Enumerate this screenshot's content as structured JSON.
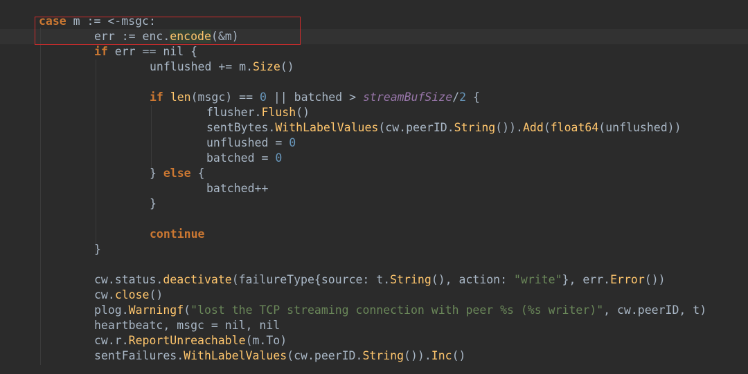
{
  "editor": {
    "theme_colors": {
      "background": "#2b2b2b",
      "caret_row": "#323232",
      "keyword": "#cc7832",
      "function": "#ffc66d",
      "string": "#6a8759",
      "number": "#6897bb",
      "constant": "#9876aa",
      "default": "#a9b7c6",
      "highlight_box": "#d22b2b"
    },
    "lines": [
      [
        {
          "t": "kw",
          "v": "case"
        },
        {
          "t": "",
          "v": " m := <-msgc:"
        }
      ],
      [
        {
          "t": "",
          "v": "err := enc."
        },
        {
          "t": "fn hl",
          "v": "encode"
        },
        {
          "t": "",
          "v": "(&m)"
        }
      ],
      [
        {
          "t": "kw",
          "v": "if"
        },
        {
          "t": "",
          "v": " err == nil {"
        }
      ],
      [
        {
          "t": "",
          "v": "unflushed += m."
        },
        {
          "t": "fn",
          "v": "Size"
        },
        {
          "t": "",
          "v": "()"
        }
      ],
      [],
      [
        {
          "t": "kw",
          "v": "if"
        },
        {
          "t": "",
          "v": " "
        },
        {
          "t": "fn",
          "v": "len"
        },
        {
          "t": "",
          "v": "(msgc) == "
        },
        {
          "t": "num",
          "v": "0"
        },
        {
          "t": "",
          "v": " || batched > "
        },
        {
          "t": "const",
          "v": "streamBufSize"
        },
        {
          "t": "",
          "v": "/"
        },
        {
          "t": "num",
          "v": "2"
        },
        {
          "t": "",
          "v": " {"
        }
      ],
      [
        {
          "t": "",
          "v": "flusher."
        },
        {
          "t": "fn",
          "v": "Flush"
        },
        {
          "t": "",
          "v": "()"
        }
      ],
      [
        {
          "t": "",
          "v": "sentBytes."
        },
        {
          "t": "fn",
          "v": "WithLabelValues"
        },
        {
          "t": "",
          "v": "(cw.peerID."
        },
        {
          "t": "fn",
          "v": "String"
        },
        {
          "t": "",
          "v": "())."
        },
        {
          "t": "fn",
          "v": "Add"
        },
        {
          "t": "",
          "v": "("
        },
        {
          "t": "fn",
          "v": "float64"
        },
        {
          "t": "",
          "v": "(unflushed))"
        }
      ],
      [
        {
          "t": "",
          "v": "unflushed = "
        },
        {
          "t": "num",
          "v": "0"
        }
      ],
      [
        {
          "t": "",
          "v": "batched = "
        },
        {
          "t": "num",
          "v": "0"
        }
      ],
      [
        {
          "t": "",
          "v": "} "
        },
        {
          "t": "kw",
          "v": "else"
        },
        {
          "t": "",
          "v": " {"
        }
      ],
      [
        {
          "t": "",
          "v": "batched++"
        }
      ],
      [
        {
          "t": "",
          "v": "}"
        }
      ],
      [],
      [
        {
          "t": "kw",
          "v": "continue"
        }
      ],
      [
        {
          "t": "",
          "v": "}"
        }
      ],
      [],
      [
        {
          "t": "",
          "v": "cw.status."
        },
        {
          "t": "fn",
          "v": "deactivate"
        },
        {
          "t": "",
          "v": "(failureType{source: t."
        },
        {
          "t": "fn",
          "v": "String"
        },
        {
          "t": "",
          "v": "(), action: "
        },
        {
          "t": "str",
          "v": "\"write\""
        },
        {
          "t": "",
          "v": "}, err."
        },
        {
          "t": "fn",
          "v": "Error"
        },
        {
          "t": "",
          "v": "())"
        }
      ],
      [
        {
          "t": "",
          "v": "cw."
        },
        {
          "t": "fn",
          "v": "close"
        },
        {
          "t": "",
          "v": "()"
        }
      ],
      [
        {
          "t": "",
          "v": "plog."
        },
        {
          "t": "fn",
          "v": "Warningf"
        },
        {
          "t": "",
          "v": "("
        },
        {
          "t": "str",
          "v": "\"lost the TCP streaming connection with peer %s (%s writer)\""
        },
        {
          "t": "",
          "v": ", cw.peerID, t)"
        }
      ],
      [
        {
          "t": "",
          "v": "heartbeatc, msgc = nil, nil"
        }
      ],
      [
        {
          "t": "",
          "v": "cw.r."
        },
        {
          "t": "fn",
          "v": "ReportUnreachable"
        },
        {
          "t": "",
          "v": "(m.To)"
        }
      ],
      [
        {
          "t": "",
          "v": "sentFailures."
        },
        {
          "t": "fn",
          "v": "WithLabelValues"
        },
        {
          "t": "",
          "v": "(cw.peerID."
        },
        {
          "t": "fn",
          "v": "String"
        },
        {
          "t": "",
          "v": "())."
        },
        {
          "t": "fn",
          "v": "Inc"
        },
        {
          "t": "",
          "v": "()"
        }
      ]
    ]
  }
}
